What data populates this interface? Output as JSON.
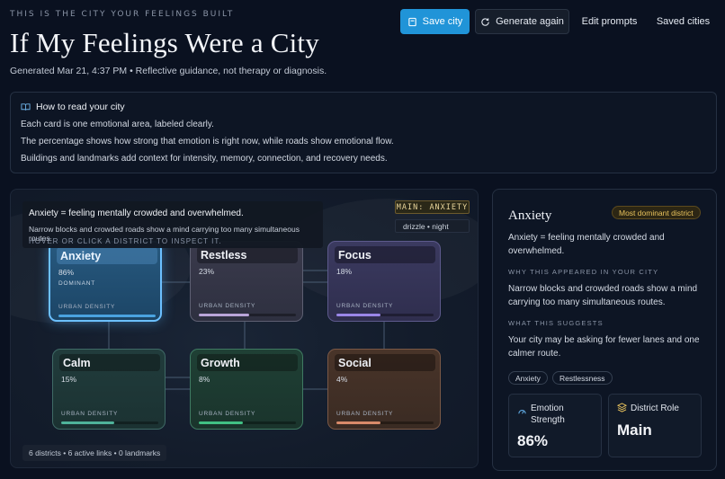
{
  "header": {
    "eyebrow": "THIS IS THE CITY YOUR FEELINGS BUILT",
    "title": "If My Feelings Were a City",
    "subtitle": "Generated Mar 21, 4:37 PM • Reflective guidance, not therapy or diagnosis."
  },
  "toolbar": {
    "save_label": "Save city",
    "generate_label": "Generate again",
    "edit_label": "Edit prompts",
    "saved_label": "Saved cities"
  },
  "help": {
    "heading": "How to read your city",
    "lines": [
      "Each card is one emotional area, labeled clearly.",
      "The percentage shows how strong that emotion is right now, while roads show emotional flow.",
      "Buildings and landmarks add context for intensity, memory, connection, and recovery needs."
    ]
  },
  "map": {
    "tooltip": {
      "title": "Anxiety = feeling mentally crowded and overwhelmed.",
      "body": "Narrow blocks and crowded roads show a mind carrying too many simultaneous routes.",
      "hint": "HOVER OR CLICK A DISTRICT TO INSPECT IT."
    },
    "main_badge": "MAIN: ANXIETY",
    "weather": "drizzle • night",
    "density_label": "URBAN DENSITY",
    "dominant_label": "DOMINANT",
    "stats": "6 districts • 6 active links • 0 landmarks",
    "districts": [
      {
        "name": "Anxiety",
        "pct": "86%",
        "density": 1.0,
        "color": "#4aa3e0"
      },
      {
        "name": "Restless",
        "pct": "23%",
        "density": 0.52,
        "color": "#b9a4d8"
      },
      {
        "name": "Focus",
        "pct": "18%",
        "density": 0.45,
        "color": "#9a86e8"
      },
      {
        "name": "Calm",
        "pct": "15%",
        "density": 0.55,
        "color": "#4fb39a"
      },
      {
        "name": "Growth",
        "pct": "8%",
        "density": 0.45,
        "color": "#41c184"
      },
      {
        "name": "Social",
        "pct": "4%",
        "density": 0.45,
        "color": "#d88a6a"
      }
    ]
  },
  "panel": {
    "title": "Anxiety",
    "badge": "Most dominant district",
    "definition": "Anxiety = feeling mentally crowded and overwhelmed.",
    "why_heading": "WHY THIS APPEARED IN YOUR CITY",
    "why_text": "Narrow blocks and crowded roads show a mind carrying too many simultaneous routes.",
    "suggest_heading": "WHAT THIS SUGGESTS",
    "suggest_text": "Your city may be asking for fewer lanes and one calmer route.",
    "chips": [
      "Anxiety",
      "Restlessness"
    ],
    "metrics": {
      "strength_label": "Emotion Strength",
      "strength_value": "86%",
      "role_label": "District Role",
      "role_value": "Main"
    }
  },
  "colors": {
    "accent": "#2094d8",
    "dominant_badge": "#e8c25c",
    "background": "#0a1120"
  }
}
